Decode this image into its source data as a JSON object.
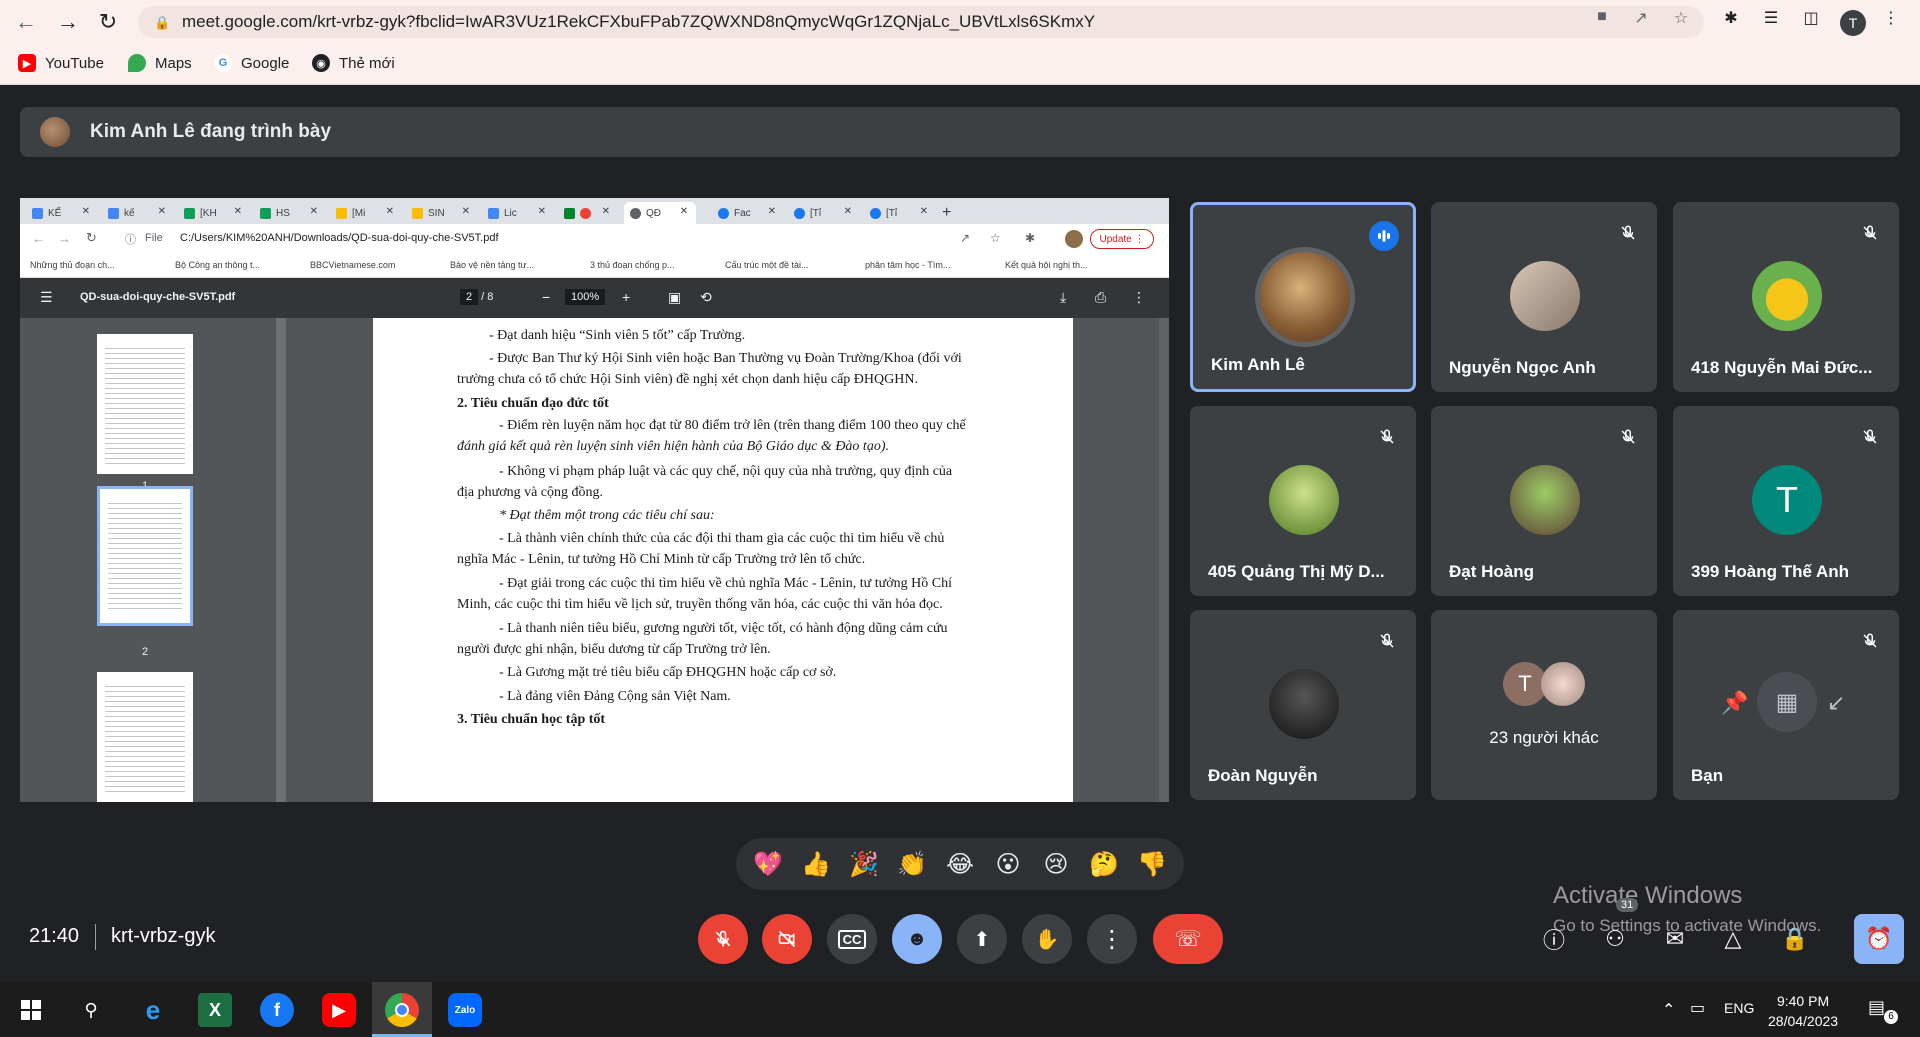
{
  "browser": {
    "url": "meet.google.com/krt-vrbz-gyk?fbclid=IwAR3VUz1RekCFXbuFPab7ZQWXND8nQmycWqGr1ZQNjaLc_UBVtLxls6SKmxY",
    "profile_initial": "T",
    "bookmarks": [
      {
        "label": "YouTube"
      },
      {
        "label": "Maps"
      },
      {
        "label": "Google"
      },
      {
        "label": "Thẻ mới"
      }
    ]
  },
  "meet": {
    "presenter_text": "Kim Anh Lê đang trình bày",
    "time": "21:40",
    "meeting_code": "krt-vrbz-gyk",
    "participant_count_badge": "31",
    "reactions": [
      "💖",
      "👍",
      "🎉",
      "👏",
      "😂",
      "😮",
      "😢",
      "🤔",
      "👎"
    ],
    "tiles": [
      {
        "name": "Kim Anh Lê",
        "speaking": true
      },
      {
        "name": "Nguyễn Ngọc Anh",
        "speaking": false
      },
      {
        "name": "418 Nguyễn Mai Đức...",
        "speaking": false
      },
      {
        "name": "405 Quảng Thị Mỹ D...",
        "speaking": false
      },
      {
        "name": "Đạt Hoàng",
        "speaking": false
      },
      {
        "name": "399 Hoàng Thế Anh",
        "speaking": false,
        "initial": "T",
        "color": "#00897b"
      },
      {
        "name": "Đoàn Nguyễn",
        "speaking": false
      },
      {
        "name": "23 người khác",
        "speaking": false,
        "initial": "T"
      },
      {
        "name": "Bạn",
        "speaking": false
      }
    ],
    "activate_windows_title": "Activate Windows",
    "activate_windows_sub": "Go to Settings to activate Windows."
  },
  "shared_screen": {
    "tabs": [
      "KẾ",
      "kế",
      "[KH",
      "HS",
      "[Mi",
      "SIN",
      "Lic",
      "",
      "QĐ",
      "Fac",
      "[Tỉ",
      "[Tỉ"
    ],
    "file_label": "File",
    "path": "C:/Users/KIM%20ANH/Downloads/QD-sua-doi-quy-che-SV5T.pdf",
    "update_label": "Update",
    "bookmarks": [
      "Những thủ đoạn ch...",
      "Bộ Công an thông t...",
      "BBCVietnamese.com",
      "Bảo vệ nền tảng tư...",
      "3 thủ đoạn chống p...",
      "Cấu trúc một đề tài...",
      "phân tâm học - Tìm...",
      "Kết quả hội nghị th..."
    ],
    "pdf": {
      "filename": "QD-sua-doi-quy-che-SV5T.pdf",
      "page_current": "2",
      "page_total": "8",
      "zoom": "100%",
      "thumb_labels": [
        "1",
        "2"
      ],
      "lines": [
        {
          "text": "- Đạt danh hiệu “Sinh viên 5 tốt” cấp Trường."
        },
        {
          "text": "- Được Ban Thư ký Hội Sinh viên hoặc Ban Thường vụ Đoàn Trường/Khoa (đối với"
        },
        {
          "text": "trường chưa có tổ chức Hội Sinh viên) đề nghị xét chọn danh hiệu cấp ĐHQGHN."
        },
        {
          "text": "2. Tiêu chuẩn đạo đức tốt"
        },
        {
          "text": "- Điểm rèn luyện năm học đạt từ 80 điểm trở lên (trên thang điểm 100 theo quy chế"
        },
        {
          "text": "đánh giá kết quả rèn luyện sinh viên hiện hành của Bộ Giáo dục & Đào tạo)."
        },
        {
          "text": "- Không vi phạm pháp luật và các quy chế, nội quy của nhà trường, quy định của"
        },
        {
          "text": "địa phương và cộng đồng."
        },
        {
          "text": "* Đạt thêm một trong các tiêu chí sau:"
        },
        {
          "text": "- Là thành viên chính thức của các đội thi tham gia các cuộc thi tìm hiểu về chủ"
        },
        {
          "text": "nghĩa Mác - Lênin, tư tưởng Hồ Chí Minh từ cấp Trường trở lên tổ chức."
        },
        {
          "text": "- Đạt giải trong các cuộc thi tìm hiểu về chủ nghĩa Mác - Lênin, tư tưởng Hồ Chí"
        },
        {
          "text": "Minh, các cuộc thi tìm hiểu về lịch sử, truyền thống văn hóa, các cuộc thi văn hóa đọc."
        },
        {
          "text": "- Là thanh niên tiêu biểu, gương người tốt, việc tốt, có hành động dũng cảm cứu"
        },
        {
          "text": "người được ghi nhận, biểu dương từ cấp Trường trở lên."
        },
        {
          "text": "- Là Gương mặt trẻ tiêu biểu cấp ĐHQGHN hoặc cấp cơ sở."
        },
        {
          "text": "- Là đảng viên Đảng Cộng sản Việt Nam."
        },
        {
          "text": "3. Tiêu chuẩn học tập tốt"
        }
      ]
    }
  },
  "taskbar": {
    "lang": "ENG",
    "clock_time": "9:40 PM",
    "clock_date": "28/04/2023",
    "notif_count": "6"
  }
}
